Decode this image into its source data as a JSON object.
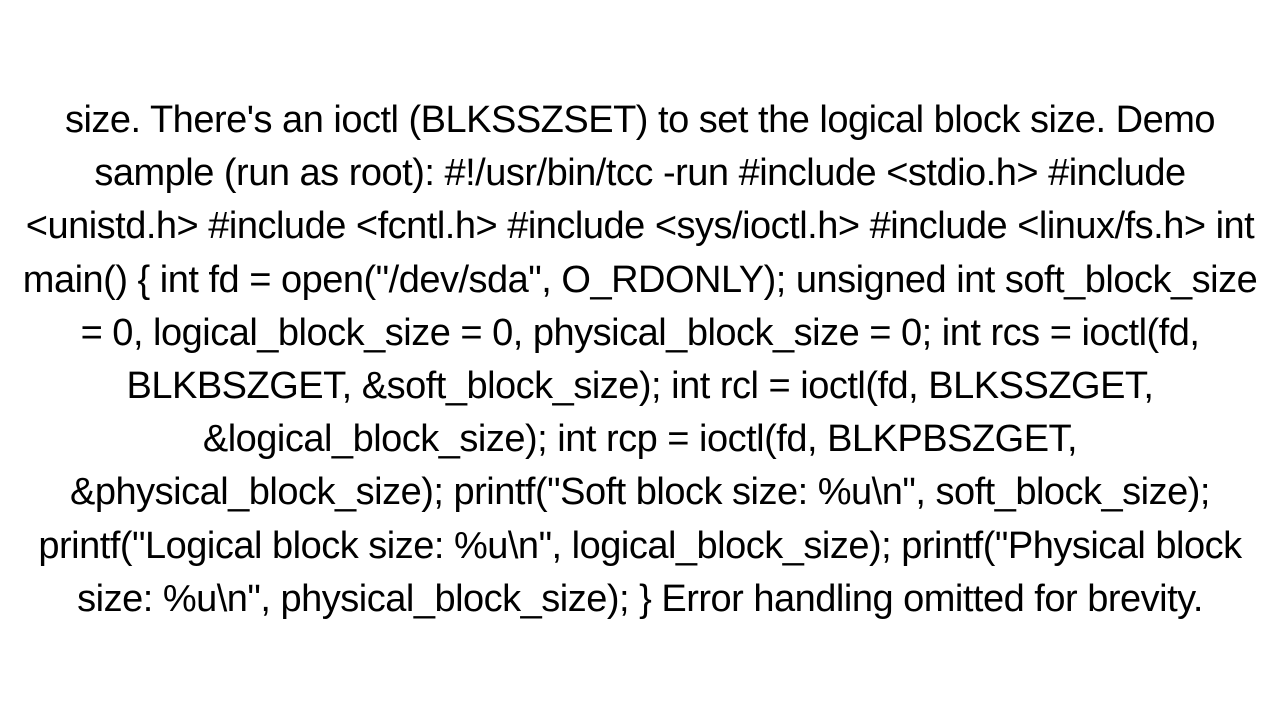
{
  "document": {
    "text": "size. There's an ioctl (BLKSSZSET) to set the logical block size. Demo sample (run as root): #!/usr/bin/tcc -run #include <stdio.h> #include <unistd.h> #include <fcntl.h> #include <sys/ioctl.h> #include <linux/fs.h>  int main() { int fd = open(\"/dev/sda\", O_RDONLY);   unsigned int soft_block_size = 0, logical_block_size = 0, physical_block_size = 0;   int rcs = ioctl(fd, BLKBSZGET, &soft_block_size);   int rcl = ioctl(fd, BLKSSZGET, &logical_block_size);   int rcp = ioctl(fd, BLKPBSZGET, &physical_block_size);   printf(\"Soft block size: %u\\n\", soft_block_size);   printf(\"Logical block size: %u\\n\", logical_block_size);   printf(\"Physical block size: %u\\n\", physical_block_size); }  Error handling omitted for brevity."
  }
}
